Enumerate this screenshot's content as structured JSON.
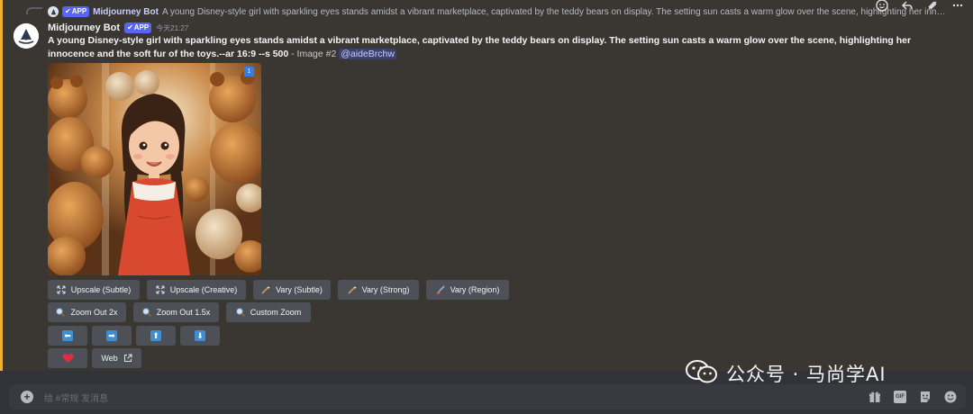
{
  "reply_preview": {
    "author": "Midjourney Bot",
    "badge": "APP",
    "text": "A young Disney-style girl with sparkling eyes stands amidst a vibrant marketplace, captivated by the teddy bears on display. The setting sun casts a warm glow over the scene, highlighting her innocence and th"
  },
  "message": {
    "author": "Midjourney Bot",
    "badge": "APP",
    "timestamp": "今天21:27",
    "prompt_text": "A young Disney-style girl with sparkling eyes stands amidst a vibrant marketplace, captivated by the teddy bears on display. The setting sun casts a warm glow over the scene, highlighting her innocence and the soft fur of the toys.--ar 16:9 --s 500",
    "meta": " - Image #2 ",
    "mention": "@aideBrchw",
    "image_corner_label": "1"
  },
  "buttons": {
    "row1": [
      {
        "label": "Upscale (Subtle)",
        "icon": "upscale-icon"
      },
      {
        "label": "Upscale (Creative)",
        "icon": "upscale-icon"
      },
      {
        "label": "Vary (Subtle)",
        "icon": "magic-wand-icon"
      },
      {
        "label": "Vary (Strong)",
        "icon": "magic-wand-icon"
      },
      {
        "label": "Vary (Region)",
        "icon": "brush-icon"
      }
    ],
    "row2": [
      {
        "label": "Zoom Out 2x",
        "icon": "magnifier-icon"
      },
      {
        "label": "Zoom Out 1.5x",
        "icon": "magnifier-icon"
      },
      {
        "label": "Custom Zoom",
        "icon": "magnifier-icon"
      }
    ],
    "row3": [
      {
        "icon": "arrow-left-icon",
        "glyph": "⬅"
      },
      {
        "icon": "arrow-right-icon",
        "glyph": "➡"
      },
      {
        "icon": "arrow-up-icon",
        "glyph": "⬆"
      },
      {
        "icon": "arrow-down-icon",
        "glyph": "⬇"
      }
    ],
    "row4": [
      {
        "icon": "heart-icon"
      },
      {
        "label": "Web",
        "icon": "external-link-icon"
      }
    ]
  },
  "composer": {
    "placeholder": "给 #常规 发消息"
  },
  "watermark": {
    "text": "公众号 · 马尚学AI"
  },
  "colors": {
    "accent": "#5865f2",
    "highlight_bar": "#f0b232",
    "button_bg": "#4e5058"
  }
}
